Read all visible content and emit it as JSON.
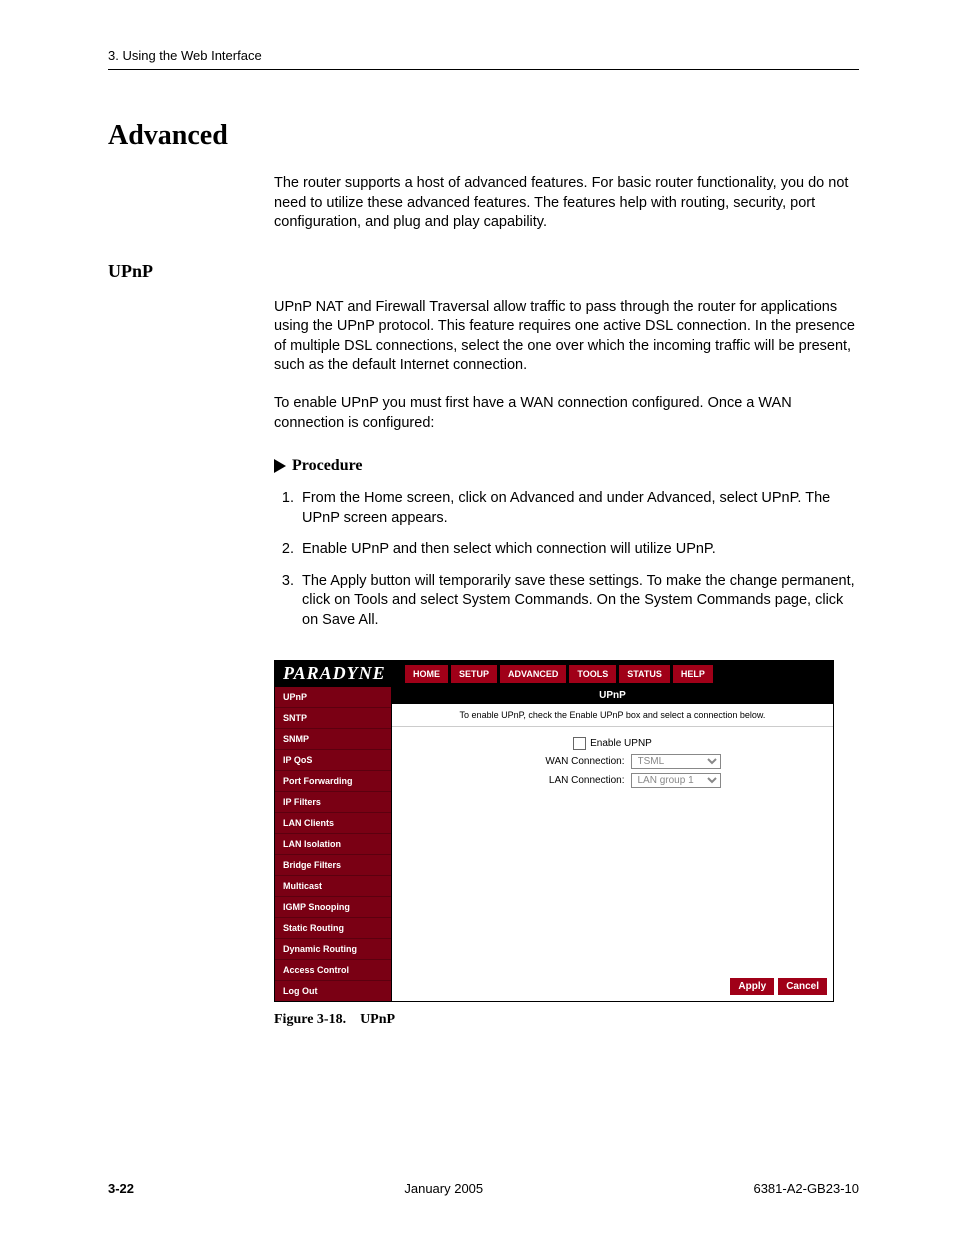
{
  "header": {
    "running": "3. Using the Web Interface"
  },
  "sections": {
    "h1": "Advanced",
    "intro": "The router supports a host of advanced features. For basic router functionality, you do not need to utilize these advanced features. The features help with routing, security, port configuration, and plug and play capability.",
    "h2": "UPnP",
    "p1": "UPnP NAT and Firewall Traversal allow traffic to pass through the router for applications using the UPnP protocol. This feature requires one active DSL connection. In the presence of multiple DSL connections, select the one over which the incoming traffic will be present, such as the default Internet connection.",
    "p2": "To enable UPnP you must first have a WAN connection configured. Once a WAN connection is configured:",
    "procLabel": "Procedure",
    "steps": {
      "s1": "From the Home screen, click on Advanced and under Advanced, select UPnP. The UPnP screen appears.",
      "s2": "Enable UPnP and then select which connection will utilize UPnP.",
      "s3": "The Apply button will temporarily save these settings. To make the change permanent, click on Tools and select System Commands. On the System Commands page, click on Save All."
    }
  },
  "figure": {
    "brand": "PARADYNE",
    "tabs": {
      "t0": "HOME",
      "t1": "SETUP",
      "t2": "ADVANCED",
      "t3": "TOOLS",
      "t4": "STATUS",
      "t5": "HELP"
    },
    "sidebar": {
      "i0": "UPnP",
      "i1": "SNTP",
      "i2": "SNMP",
      "i3": "IP QoS",
      "i4": "Port Forwarding",
      "i5": "IP Filters",
      "i6": "LAN Clients",
      "i7": "LAN Isolation",
      "i8": "Bridge Filters",
      "i9": "Multicast",
      "i10": "IGMP Snooping",
      "i11": "Static Routing",
      "i12": "Dynamic Routing",
      "i13": "Access Control",
      "logout": "Log Out"
    },
    "content": {
      "title": "UPnP",
      "sub": "To enable UPnP, check the Enable UPnP box and select a connection below.",
      "enable": "Enable UPNP",
      "wanLabel": "WAN Connection:",
      "wanVal": "TSML",
      "lanLabel": "LAN Connection:",
      "lanVal": "LAN group 1",
      "apply": "Apply",
      "cancel": "Cancel"
    },
    "caption": "Figure 3-18. UPnP"
  },
  "footer": {
    "page": "3-22",
    "date": "January 2005",
    "doc": "6381-A2-GB23-10"
  }
}
